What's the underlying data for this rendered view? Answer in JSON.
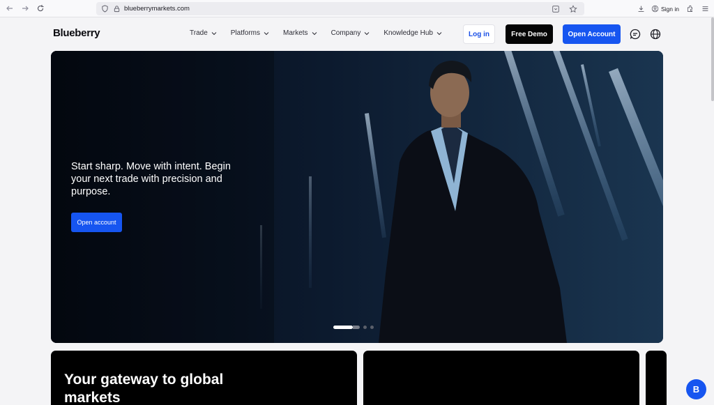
{
  "browser": {
    "url": "blueberrymarkets.com",
    "signin_label": "Sign in"
  },
  "site": {
    "logo": "Blueberry",
    "nav": [
      {
        "label": "Trade"
      },
      {
        "label": "Platforms"
      },
      {
        "label": "Markets"
      },
      {
        "label": "Company"
      },
      {
        "label": "Knowledge Hub"
      }
    ],
    "login_label": "Log in",
    "demo_label": "Free Demo",
    "open_account_label": "Open Account"
  },
  "hero": {
    "headline": "Start sharp. Move with intent. Begin your next trade with precision and purpose.",
    "cta_label": "Open account",
    "carousel_active_index": 0,
    "carousel_count": 3
  },
  "cards": {
    "card1_title": "Your gateway to global markets"
  },
  "chat": {
    "badge_letter": "B"
  },
  "colors": {
    "accent": "#1655f0",
    "hero_bg": "#0a1220",
    "card_bg": "#000000"
  }
}
